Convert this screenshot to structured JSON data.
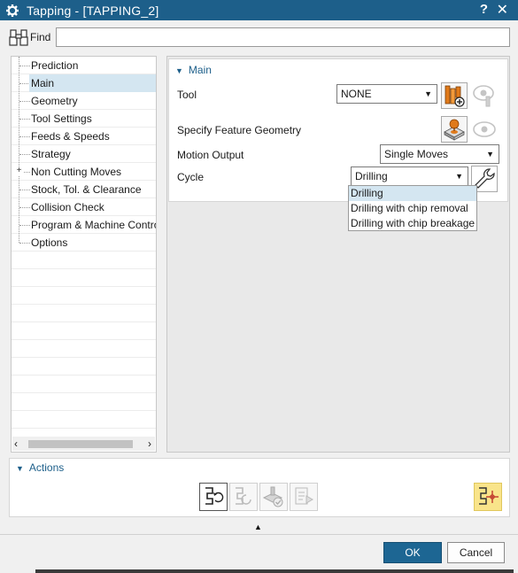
{
  "window": {
    "title": "Tapping - [TAPPING_2]",
    "help_label": "?",
    "close_label": "✕"
  },
  "find": {
    "label": "Find",
    "value": ""
  },
  "tree": {
    "items": [
      {
        "label": "Prediction"
      },
      {
        "label": "Main"
      },
      {
        "label": "Geometry"
      },
      {
        "label": "Tool Settings"
      },
      {
        "label": "Feeds & Speeds"
      },
      {
        "label": "Strategy"
      },
      {
        "label": "Non Cutting Moves"
      },
      {
        "label": "Stock, Tol. & Clearance"
      },
      {
        "label": "Collision Check"
      },
      {
        "label": "Program & Machine Control"
      },
      {
        "label": "Options"
      }
    ],
    "selected": "Main",
    "expandable": "Non Cutting Moves",
    "expander_glyph": "+",
    "scroll_left": "‹",
    "scroll_right": "›"
  },
  "main": {
    "title": "Main",
    "tool_label": "Tool",
    "tool_value": "NONE",
    "feature_geometry_label": "Specify Feature Geometry",
    "motion_output_label": "Motion Output",
    "motion_output_value": "Single Moves",
    "cycle_label": "Cycle",
    "cycle_value": "Drilling",
    "cycle_options": [
      "Drilling",
      "Drilling with chip removal",
      "Drilling with chip breakage"
    ],
    "caret": "▼",
    "collapse_glyph": "▼"
  },
  "actions": {
    "title": "Actions",
    "collapse_glyph": "▼"
  },
  "footer": {
    "collapse_glyph": "▲",
    "ok_label": "OK",
    "cancel_label": "Cancel"
  },
  "colors": {
    "accent": "#1d5f8a",
    "ok_button": "#1d6693",
    "selection": "#d4e6f1",
    "highlight_icon": "#f9e48a"
  },
  "icons": {
    "title": "gear-icon",
    "find": "binoculars-icon",
    "tool_new": "new-tool-icon",
    "tool_view": "display-tool-icon",
    "feature_geometry": "feature-geometry-icon",
    "feature_view": "display-icon",
    "cycle_edit": "wrench-icon",
    "generate": "generate-icon",
    "replay": "replay-icon",
    "verify": "verify-icon",
    "list": "list-icon",
    "highlight": "highlight-icon"
  }
}
